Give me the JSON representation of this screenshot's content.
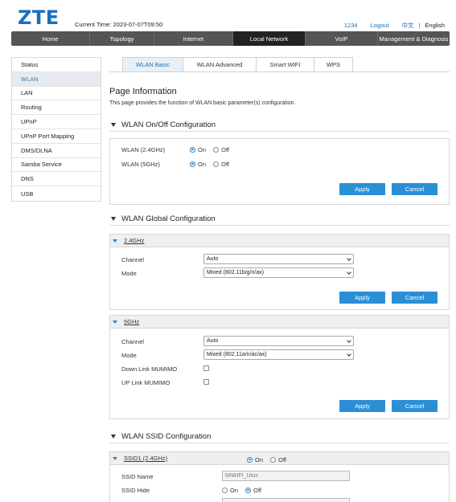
{
  "brand": {
    "logo": "ZTE"
  },
  "header": {
    "current_time_label": "Current Time:",
    "current_time": "2023-07-07T09:50",
    "user": "1234",
    "logout": "Logout",
    "lang_zh": "中文",
    "lang_sep": "|",
    "lang_en": "English"
  },
  "nav": [
    "Home",
    "Topology",
    "Internet",
    "Local Network",
    "VoIP",
    "Management & Diagnosis"
  ],
  "nav_active": "Local Network",
  "sidebar": [
    "Status",
    "WLAN",
    "LAN",
    "Routing",
    "UPnP",
    "UPnP Port Mapping",
    "DMS/DLNA",
    "Samba Service",
    "DNS",
    "USB"
  ],
  "sidebar_active": "WLAN",
  "tabs": [
    "WLAN Basic",
    "WLAN Advanced",
    "Smart WIFI",
    "WPS"
  ],
  "tab_active": "WLAN Basic",
  "page_info": {
    "title": "Page Information",
    "desc": "This page provides the function of WLAN basic parameter(s) configuration."
  },
  "onoff": {
    "title": "WLAN On/Off Configuration",
    "wlan24_label": "WLAN (2.4GHz)",
    "wlan5_label": "WLAN (5GHz)",
    "on": "On",
    "off": "Off",
    "wlan24_value": "On",
    "wlan5_value": "On",
    "apply": "Apply",
    "cancel": "Cancel"
  },
  "global": {
    "title": "WLAN Global Configuration",
    "band24": {
      "name": "2.4GHz",
      "channel_label": "Channel",
      "channel_value": "Auto",
      "mode_label": "Mode",
      "mode_value": "Mixed (802.11b/g/n/ax)",
      "apply": "Apply",
      "cancel": "Cancel"
    },
    "band5": {
      "name": "5GHz",
      "channel_label": "Channel",
      "channel_value": "Auto",
      "mode_label": "Mode",
      "mode_value": "Mixed (802.11a/n/ac/ax)",
      "dl_mumimo_label": "Down Link MUMIMO",
      "ul_mumimo_label": "UP Link MUMIMO",
      "dl_mumimo_checked": false,
      "ul_mumimo_checked": false,
      "apply": "Apply",
      "cancel": "Cancel"
    }
  },
  "ssid": {
    "title": "WLAN SSID Configuration",
    "ssid1": {
      "name": "SSID1 (2.4GHz)",
      "enable_value": "On",
      "on": "On",
      "off": "Off",
      "ssid_name_label": "SSID Name",
      "ssid_name_value": "MIWIFI_Utus",
      "ssid_hide_label": "SSID Hide",
      "ssid_hide_value": "Off"
    }
  }
}
